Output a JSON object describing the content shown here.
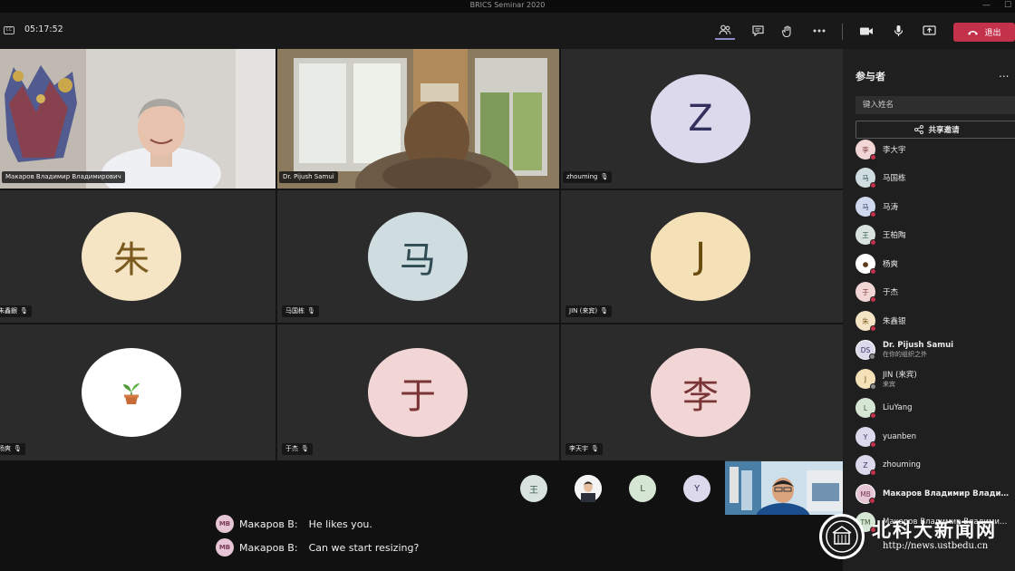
{
  "window": {
    "title": "BRICS Seminar 2020",
    "minimize": "—",
    "maximize": "☐"
  },
  "toolbar": {
    "cc_label": "CC",
    "timer": "05:17:52",
    "leave_label": "退出"
  },
  "tiles": [
    {
      "name": "Макаров Владимир Владимирович",
      "type": "video"
    },
    {
      "name": "Dr. Pijush Samui",
      "type": "video"
    },
    {
      "name": "zhouming",
      "type": "avatar",
      "initial": "Z",
      "bg": "#dcd9ec",
      "fg": "#34305e"
    },
    {
      "name": "朱鑫銀",
      "type": "avatar",
      "initial": "朱",
      "bg": "#f5e5c4",
      "fg": "#7a5a1e"
    },
    {
      "name": "马国栋",
      "type": "avatar",
      "initial": "马",
      "bg": "#cfdde0",
      "fg": "#2f4b54"
    },
    {
      "name": "JIN (来宾)",
      "type": "avatar",
      "initial": "J",
      "bg": "#f5e1b7",
      "fg": "#6b4c0f"
    },
    {
      "name": "杨爽",
      "type": "avatar",
      "initial": "🪴",
      "bg": "#ffffff",
      "fg": "#5a3a1a"
    },
    {
      "name": "于杰",
      "type": "avatar",
      "initial": "于",
      "bg": "#f2d5d5",
      "fg": "#7a3636"
    },
    {
      "name": "李天宇",
      "type": "avatar",
      "initial": "李",
      "bg": "#f2d5d5",
      "fg": "#7a3636"
    }
  ],
  "overflow_avatars": [
    {
      "initial": "王",
      "bg": "#d8e3e0",
      "fg": "#3b5a52"
    },
    {
      "initial": "",
      "bg": "#ffffff",
      "fg": "#333"
    },
    {
      "initial": "L",
      "bg": "#d6e6d4",
      "fg": "#3d5a39"
    },
    {
      "initial": "Y",
      "bg": "#dcd9ec",
      "fg": "#34305e"
    }
  ],
  "captions": [
    {
      "badge": "MB",
      "speaker": "Макаров В:",
      "text": "He likes you."
    },
    {
      "badge": "MB",
      "speaker": "Макаров В:",
      "text": "Can we start resizing?"
    }
  ],
  "panel": {
    "title": "参与者",
    "more": "...",
    "search_placeholder": "键入姓名",
    "share_label": "共享邀请",
    "participants": [
      {
        "initial": "李",
        "name": "李大宇",
        "bg": "#f2d5d5",
        "fg": "#7a3636",
        "bold": false
      },
      {
        "initial": "马",
        "name": "马国栋",
        "bg": "#cfdde0",
        "fg": "#2f4b54",
        "bold": false
      },
      {
        "initial": "马",
        "name": "马涛",
        "bg": "#cfd8ec",
        "fg": "#2f3f5e",
        "bold": false
      },
      {
        "initial": "王",
        "name": "王柏陶",
        "bg": "#d8e3e0",
        "fg": "#3b5a52",
        "bold": false
      },
      {
        "initial": "●",
        "name": "杨爽",
        "bg": "#ffffff",
        "fg": "#5a3a1a",
        "bold": false
      },
      {
        "initial": "于",
        "name": "于杰",
        "bg": "#f2d5d5",
        "fg": "#7a3636",
        "bold": false
      },
      {
        "initial": "朱",
        "name": "朱鑫银",
        "bg": "#f5e5c4",
        "fg": "#7a5a1e",
        "bold": false
      },
      {
        "initial": "DS",
        "name": "Dr. Pijush Samui",
        "sub": "在你的组织之外",
        "bg": "#dcd9ec",
        "fg": "#34305e",
        "bold": true
      },
      {
        "initial": "J",
        "name": "JIN (来宾)",
        "sub": "来宾",
        "bg": "#f5e1b7",
        "fg": "#6b4c0f",
        "bold": false
      },
      {
        "initial": "L",
        "name": "LiuYang",
        "bg": "#d6e6d4",
        "fg": "#3d5a39",
        "bold": false
      },
      {
        "initial": "Y",
        "name": "yuanben",
        "bg": "#dcd9ec",
        "fg": "#34305e",
        "bold": false
      },
      {
        "initial": "Z",
        "name": "zhouming",
        "bg": "#dcd9ec",
        "fg": "#34305e",
        "bold": false
      },
      {
        "initial": "MB",
        "name": "Макаров Владимир Влади...",
        "bg": "#e6c6d4",
        "fg": "#7a3b59",
        "bold": true
      },
      {
        "initial": "TM",
        "name": "Макаров Владимир Владимирович",
        "bg": "#d6e6d4",
        "fg": "#3d5a39",
        "bold": false
      }
    ]
  },
  "watermark": {
    "title": "北科大新闻网",
    "url": "http://news.ustbedu.cn"
  },
  "colors": {
    "leave": "#c4314b",
    "active_tab": "#8b8cc7"
  }
}
